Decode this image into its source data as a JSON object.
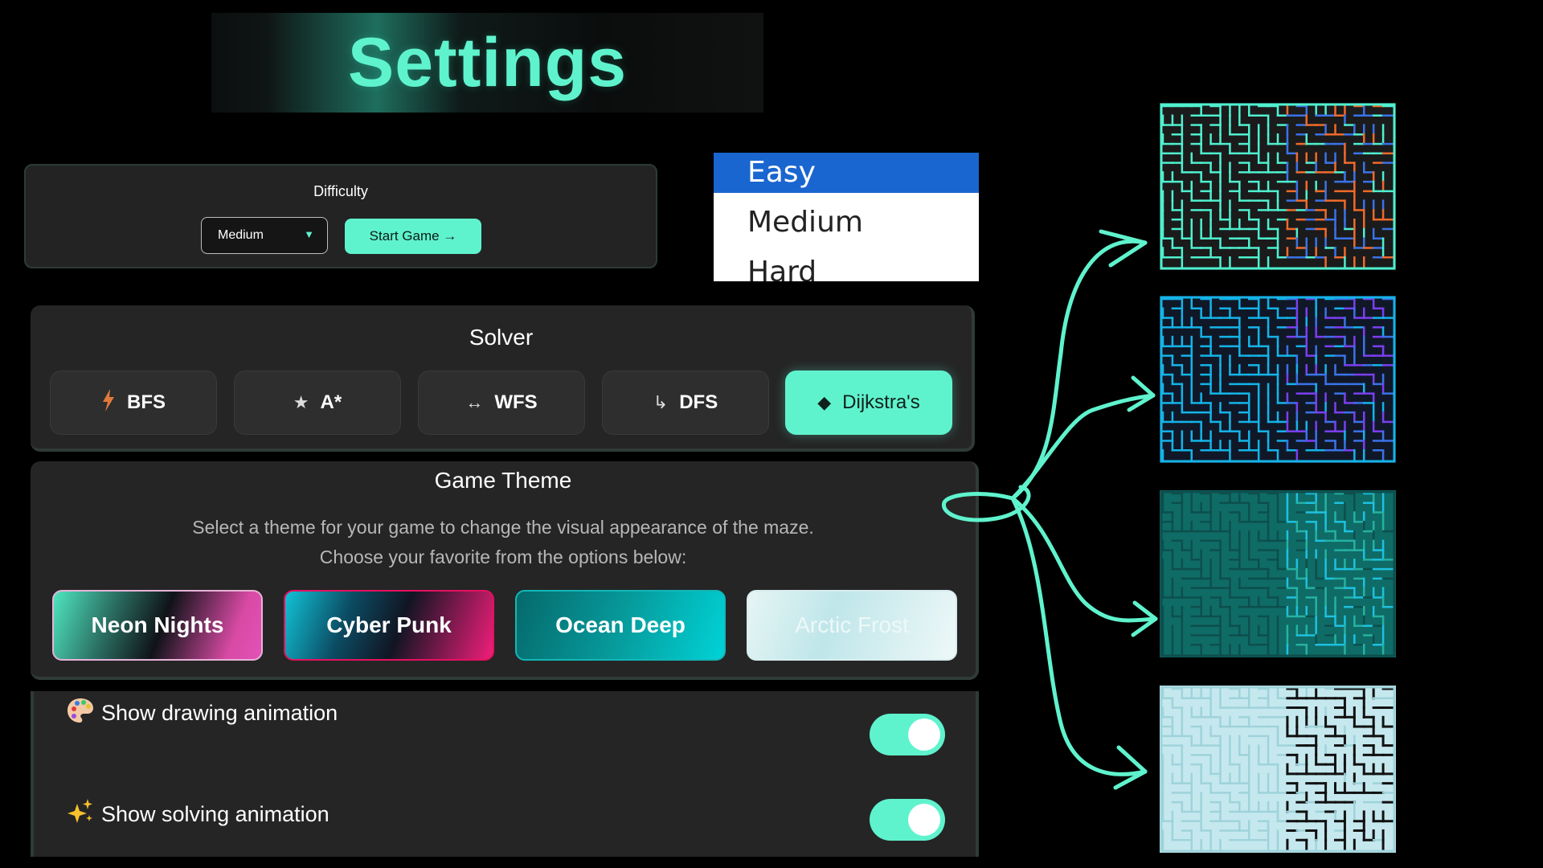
{
  "header": {
    "title": "Settings"
  },
  "difficulty": {
    "title": "Difficulty",
    "selected": "Medium",
    "start_button": "Start Game →",
    "options": [
      "Easy",
      "Medium",
      "Hard"
    ],
    "highlighted_option": "Easy"
  },
  "solver": {
    "title": "Solver",
    "algorithms": [
      {
        "label": "BFS",
        "icon": "lightning-icon",
        "active": false
      },
      {
        "label": "A*",
        "icon": "star-icon",
        "active": false
      },
      {
        "label": "WFS",
        "icon": "double-arrow-icon",
        "active": false
      },
      {
        "label": "DFS",
        "icon": "down-right-arrow-icon",
        "active": false
      },
      {
        "label": "Dijkstra's",
        "icon": "diamond-icon",
        "active": true
      }
    ]
  },
  "theme": {
    "title": "Game Theme",
    "description_line1": "Select a theme for your game to change the visual appearance of the maze.",
    "description_line2": "Choose your favorite from the options below:",
    "options": [
      "Neon Nights",
      "Cyber Punk",
      "Ocean Deep",
      "Arctic Frost"
    ]
  },
  "toggles": [
    {
      "label": "Show drawing animation",
      "icon": "palette-icon",
      "on": true
    },
    {
      "label": "Show solving animation",
      "icon": "sparkles-icon",
      "on": true
    }
  ],
  "previews": [
    {
      "name": "Neon Nights maze preview",
      "background": "#1b1b1b",
      "wall": "#4ff0cf",
      "path_a": "#3a73e8",
      "path_b": "#f06a2b"
    },
    {
      "name": "Cyber Punk maze preview",
      "background": "#101828",
      "wall": "#14b4e8",
      "path_a": "#7b3ff0",
      "path_b": "#3a73e8"
    },
    {
      "name": "Ocean Deep maze preview",
      "background": "#0f6b66",
      "wall": "#0d4f4d",
      "path_a": "#1ec1df",
      "path_b": "#25b1a3"
    },
    {
      "name": "Arctic Frost maze preview",
      "background": "#c5e8ee",
      "wall": "#9fd3db",
      "path_a": "#111111",
      "path_b": "#111111"
    }
  ],
  "colors": {
    "accent": "#5ff3cd",
    "panel": "#252525",
    "background": "#000000"
  }
}
